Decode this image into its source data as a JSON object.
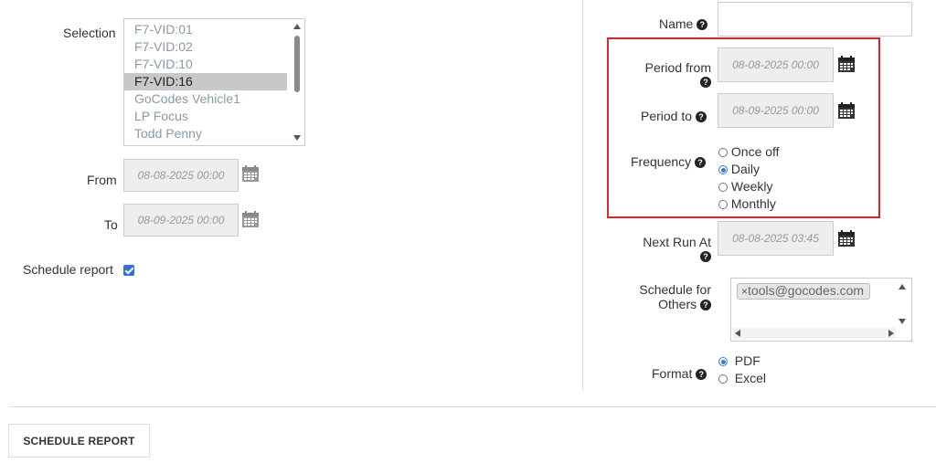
{
  "left": {
    "selection_label": "Selection",
    "selection_items": [
      {
        "label": "F7-VID:01",
        "selected": false
      },
      {
        "label": "F7-VID:02",
        "selected": false
      },
      {
        "label": "F7-VID:10",
        "selected": false
      },
      {
        "label": "F7-VID:16",
        "selected": true
      },
      {
        "label": "GoCodes Vehicle1",
        "selected": false
      },
      {
        "label": "LP Focus",
        "selected": false
      },
      {
        "label": "Todd Penny",
        "selected": false
      }
    ],
    "from_label": "From",
    "from_value": "08-08-2025 00:00",
    "to_label": "To",
    "to_value": "08-09-2025 00:00",
    "schedule_report_label": "Schedule report",
    "schedule_report_checked": true
  },
  "right": {
    "name_label": "Name",
    "name_value": "",
    "period_from_label": "Period from",
    "period_from_value": "08-08-2025 00:00",
    "period_to_label": "Period to",
    "period_to_value": "08-09-2025 00:00",
    "frequency_label": "Frequency",
    "frequency_options": [
      {
        "label": "Once off",
        "checked": false
      },
      {
        "label": "Daily",
        "checked": true
      },
      {
        "label": "Weekly",
        "checked": false
      },
      {
        "label": "Monthly",
        "checked": false
      }
    ],
    "next_run_label": "Next Run At",
    "next_run_value": "08-08-2025 03:45",
    "schedule_others_label_1": "Schedule for",
    "schedule_others_label_2": "Others",
    "schedule_others_checked": true,
    "others_tags": [
      "tools@gocodes.com"
    ],
    "format_label": "Format",
    "format_options": [
      {
        "label": "PDF",
        "checked": true
      },
      {
        "label": "Excel",
        "checked": false
      }
    ]
  },
  "footer": {
    "schedule_button_label": "SCHEDULE REPORT"
  },
  "icons": {
    "help": "?",
    "tag_remove": "×"
  },
  "colors": {
    "highlight_border": "#e0232b",
    "accent": "#2f72d1"
  }
}
